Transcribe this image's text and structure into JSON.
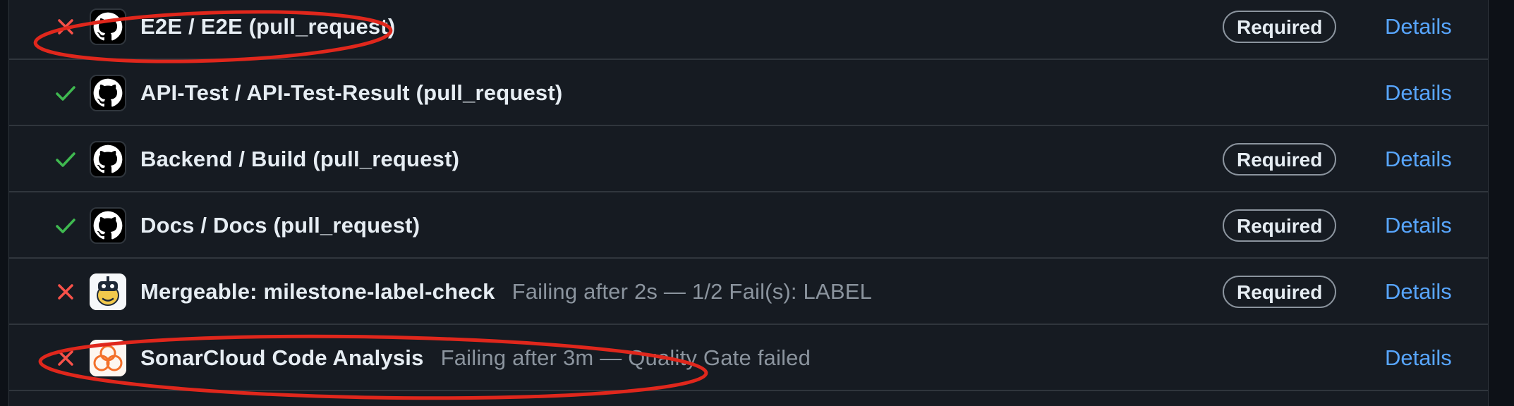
{
  "checks": [
    {
      "status": "failure",
      "status_icon": "x-icon",
      "avatar_icon": "github-icon",
      "title": "E2E / E2E (pull_request)",
      "description": "",
      "required_label": "Required",
      "details_label": "Details"
    },
    {
      "status": "success",
      "status_icon": "check-icon",
      "avatar_icon": "github-icon",
      "title": "API-Test / API-Test-Result (pull_request)",
      "description": "",
      "required_label": "",
      "details_label": "Details"
    },
    {
      "status": "success",
      "status_icon": "check-icon",
      "avatar_icon": "github-icon",
      "title": "Backend / Build (pull_request)",
      "description": "",
      "required_label": "Required",
      "details_label": "Details"
    },
    {
      "status": "success",
      "status_icon": "check-icon",
      "avatar_icon": "github-icon",
      "title": "Docs / Docs (pull_request)",
      "description": "",
      "required_label": "Required",
      "details_label": "Details"
    },
    {
      "status": "failure",
      "status_icon": "x-icon",
      "avatar_icon": "mergeable-bot-icon",
      "title": "Mergeable: milestone-label-check",
      "description": "Failing after 2s — 1/2 Fail(s): LABEL",
      "required_label": "Required",
      "details_label": "Details"
    },
    {
      "status": "failure",
      "status_icon": "x-icon",
      "avatar_icon": "sonarcloud-icon",
      "title": "SonarCloud Code Analysis",
      "description": "Failing after 3m — Quality Gate failed",
      "required_label": "",
      "details_label": "Details"
    }
  ],
  "colors": {
    "background": "#161b22",
    "border": "#30363d",
    "text": "#e6edf3",
    "muted": "#8b949e",
    "link": "#58a6ff",
    "success": "#3fb950",
    "failure": "#f85149",
    "annotation": "#e0271c"
  }
}
